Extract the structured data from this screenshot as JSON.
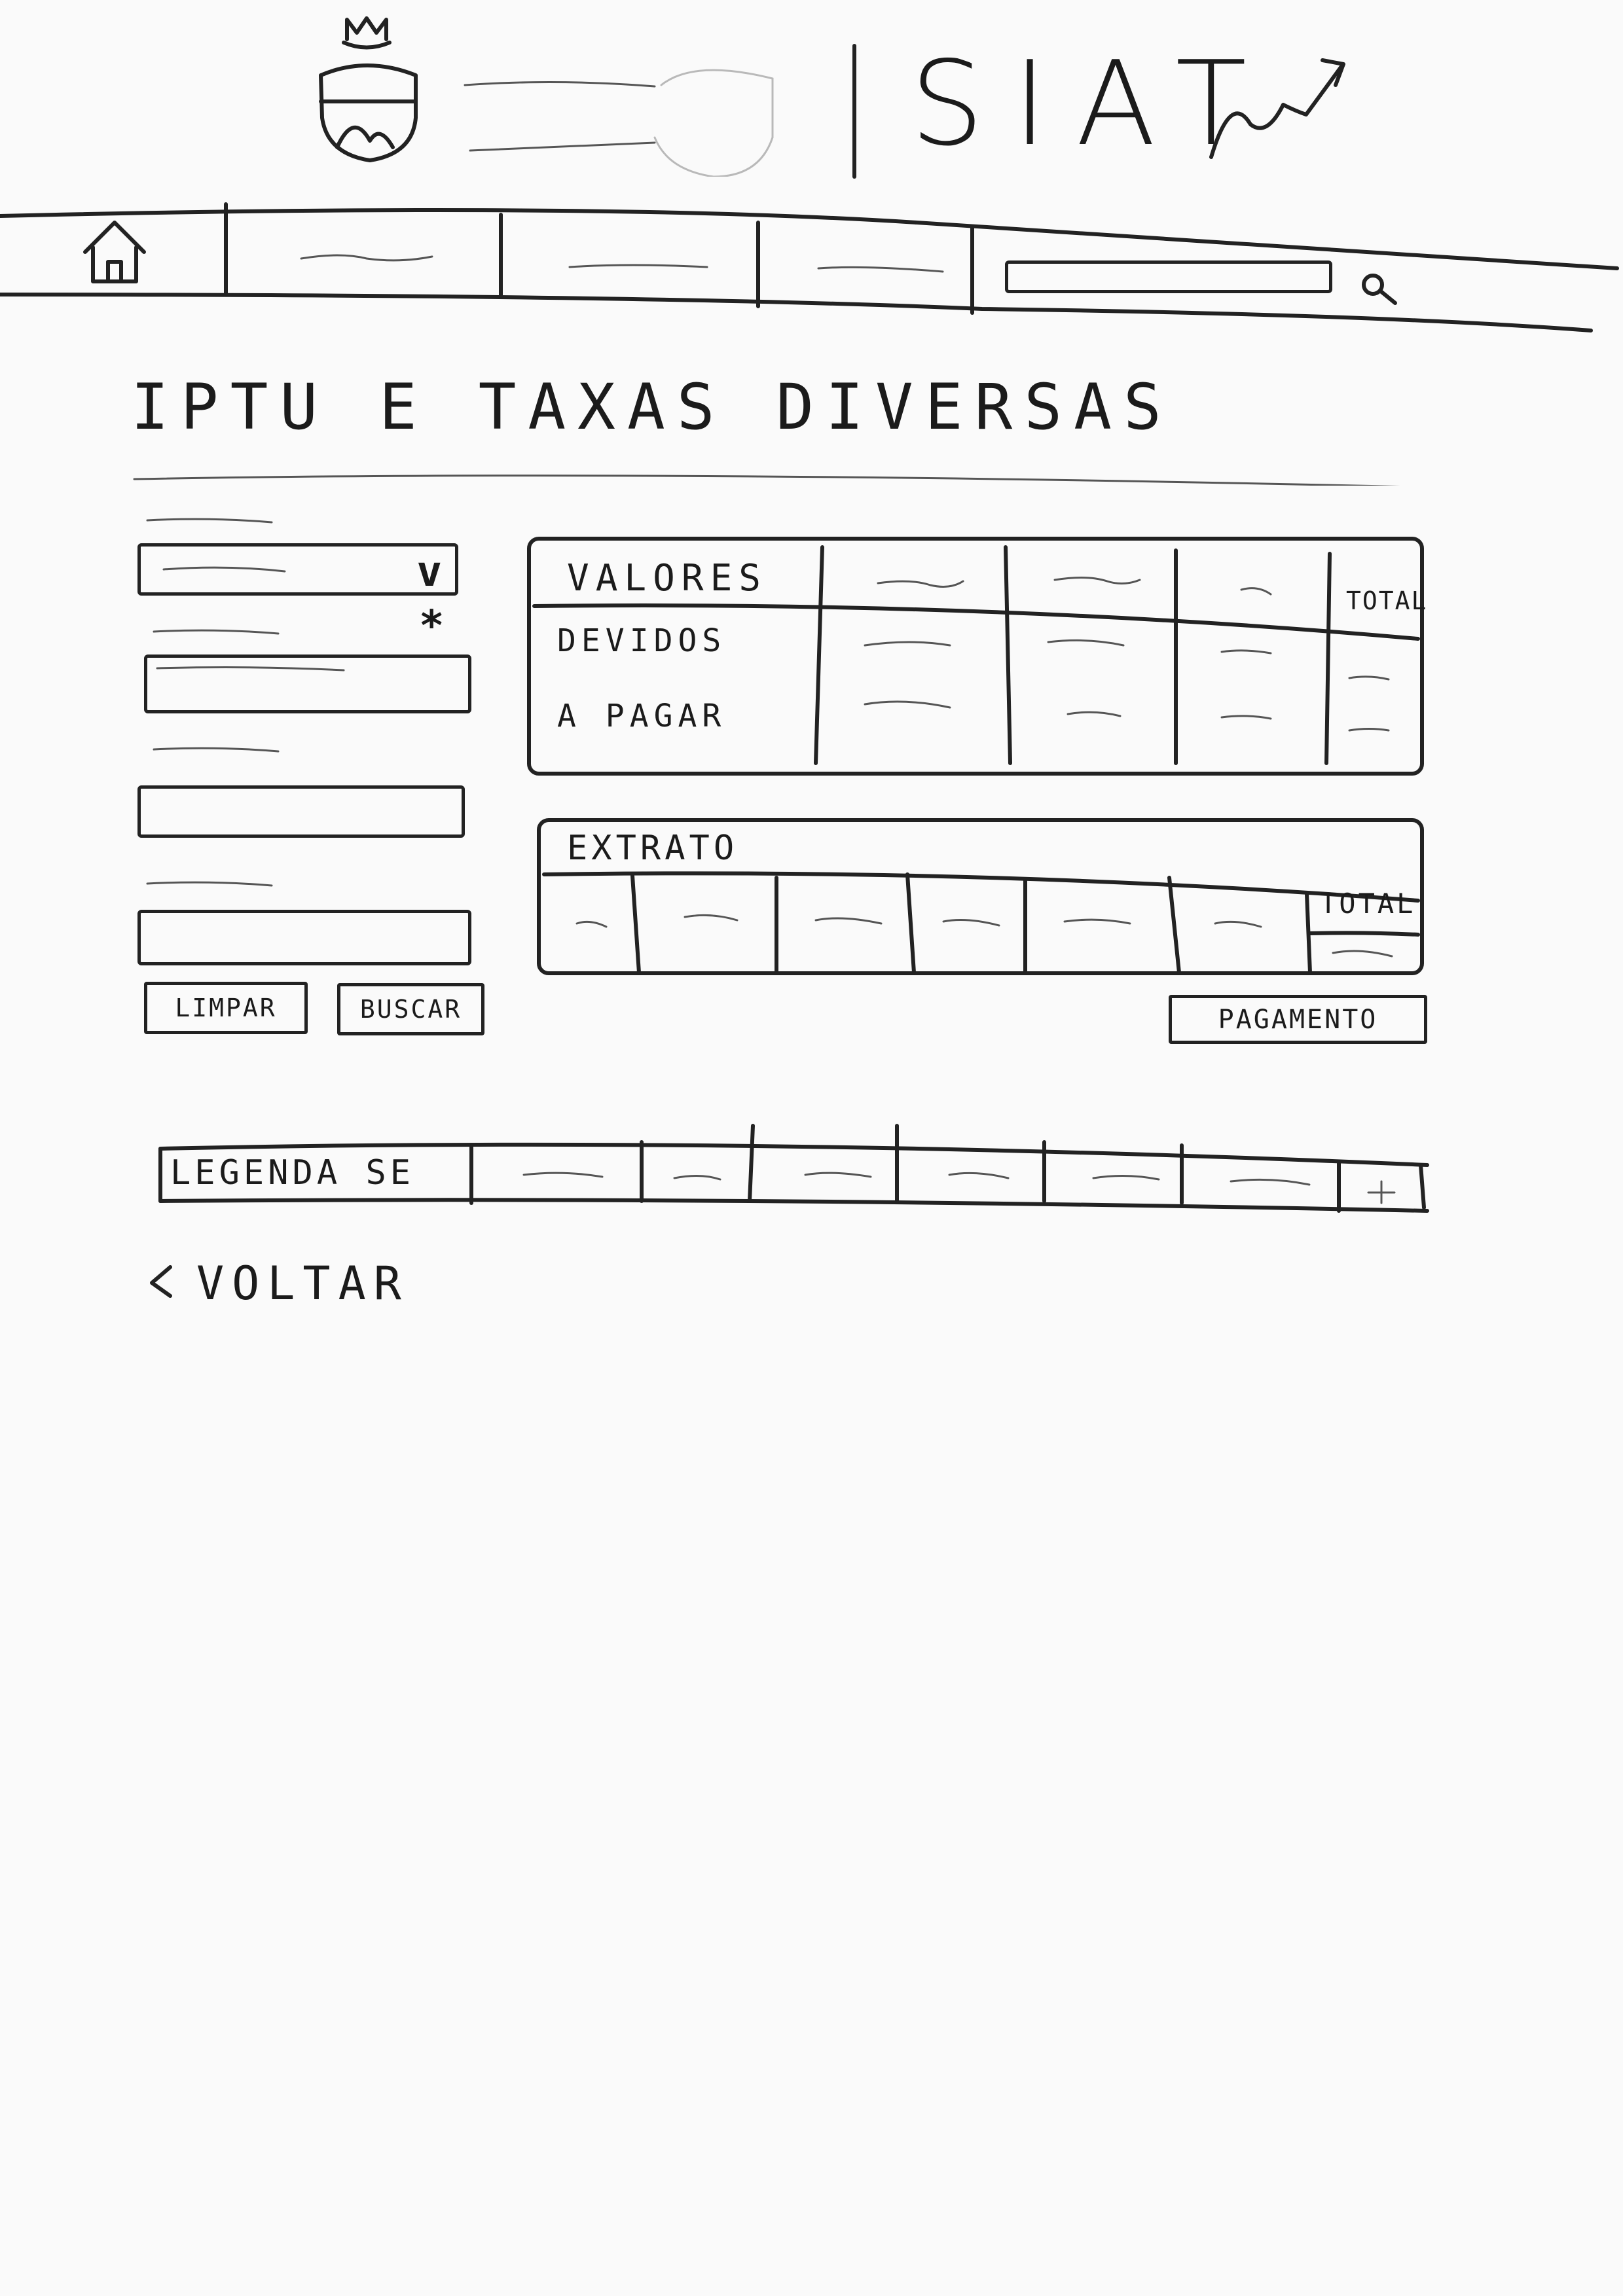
{
  "header": {
    "app_title": "SIAT",
    "logo_icon": "municipal-crest-icon",
    "chart_trend_icon": "trend-up-arrow-icon"
  },
  "nav": {
    "home_icon": "home-icon",
    "items_count_label": "",
    "search_icon": "search-icon"
  },
  "page": {
    "title": "IPTU E TAXAS DIVERSAS"
  },
  "form": {
    "select_chevron": "v",
    "required_marker": "*",
    "clear_button": "LIMPAR",
    "search_button": "BUSCAR"
  },
  "values_table": {
    "header_label": "VALORES",
    "total_label": "TOTAL",
    "rows": [
      "DEVIDOS",
      "A PAGAR"
    ]
  },
  "statement": {
    "title": "EXTRATO",
    "total_label": "TOTAL",
    "payment_button": "PAGAMENTO"
  },
  "legend": {
    "label": "LEGENDA SE"
  },
  "footer": {
    "back_label": "VOLTAR",
    "back_icon": "chevron-left-icon"
  }
}
